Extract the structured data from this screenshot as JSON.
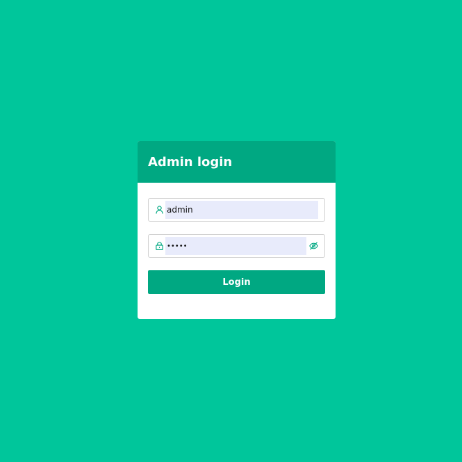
{
  "login_card": {
    "title": "Admin login",
    "username": {
      "icon": "user-icon",
      "value": "admin"
    },
    "password": {
      "icon": "lock-icon",
      "value": "•••••",
      "toggle_icon": "eye-off-icon"
    },
    "submit_label": "Login"
  },
  "colors": {
    "background": "#00c69b",
    "accent": "#00a882",
    "input_fill": "#e8ebfb"
  }
}
